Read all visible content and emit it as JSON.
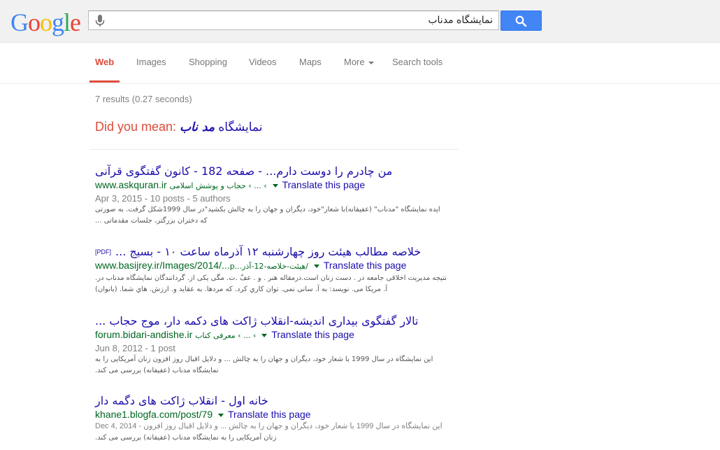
{
  "header": {
    "logo": [
      "G",
      "o",
      "o",
      "g",
      "l",
      "e"
    ],
    "logo_colors": [
      "#4285f4",
      "#ea4335",
      "#fbbc05",
      "#4285f4",
      "#34a853",
      "#ea4335"
    ],
    "query": "نمایشگاه مدناب"
  },
  "tabs": [
    {
      "label": "Web",
      "active": true
    },
    {
      "label": "Images"
    },
    {
      "label": "Shopping"
    },
    {
      "label": "Videos"
    },
    {
      "label": "Maps"
    },
    {
      "label": "More"
    },
    {
      "label": "Search tools"
    }
  ],
  "stats": "7 results (0.27 seconds)",
  "did_you_mean": {
    "label": "Did you mean:",
    "suggestion_prefix": "نمایشگاه ",
    "suggestion_bold": "مد ناب"
  },
  "results": [
    {
      "title": "من چادرم را دوست دارم... - صفحه 182 - کانون گفتگوی قرآنی",
      "url": "www.askquran.ir",
      "breadcrumb": "› ... › حجاب و پوشش اسلامی",
      "translate": "Translate this page",
      "meta": "Apr 3, 2015 - 10 posts - 5 authors",
      "snippet1": "ایده نمایشگاه \"مدناب\" (عفیفانه)با شعار\"خود، دیگران و جهان را به چالش بکشید\"در سال 1999شکل گرفت. به صورتی",
      "snippet2": "که دختران بزرگتر، جلسات مقدماتی ..."
    },
    {
      "pdf": "[PDF]",
      "title": "خلاصه مطالب هیئت روز چهارشنبه ۱۲ آذرماه ساعت ۱۰ - بسیج ...",
      "url": "www.basijrey.ir/Images/2014/...",
      "breadcrumb": "/هيئت-خلاصه-12-آذر...p",
      "translate": "Translate this page",
      "snippet1": "نتیجه مدیریت اخلاقی جامعه در . دست زنان است.درمقاله هنر . و . عفّ .ت. مگی یکی از. گردانندگان نمایشگاه مدناب در.",
      "snippet2": "آ. مریکا می. نویسد: به آ. سانی نمی. توان کاري کرد. که مردها. به عقاید و. ارزش. هاي شما. (بانوان)"
    },
    {
      "title": "تالار گفتگوی بیداری اندیشه-انقلاب ژاکت های دکمه دار، موج حجاب ...",
      "url": "forum.bidari-andishe.ir",
      "breadcrumb": "› ... › معرفی کتاب",
      "translate": "Translate this page",
      "meta": "Jun 8, 2012 - 1 post",
      "snippet1": "این نمایشگاه در سال 1999 با شعار خود، دیگران و جهان را به چالش ... و دلایل اقبال روز افزون زنان آمریکایی را به",
      "snippet2": "نمایشگاه مدناب (عفیفانه) بررسی می کند."
    },
    {
      "title": "خانه اول - انقلاب ژاکت های دگمه دار",
      "url": "khane1.blogfa.com/post/79",
      "translate": "Translate this page",
      "meta": "Dec 4, 2014 - این نمایشگاه در سال 1999 با شعار خود، دیگران و جهان را به چالش ... و دلایل اقبال روز افزون",
      "snippet2": "زنان آمریکایی را به نمایشگاه مدناب (عفیفانه) بررسی می کند."
    }
  ]
}
